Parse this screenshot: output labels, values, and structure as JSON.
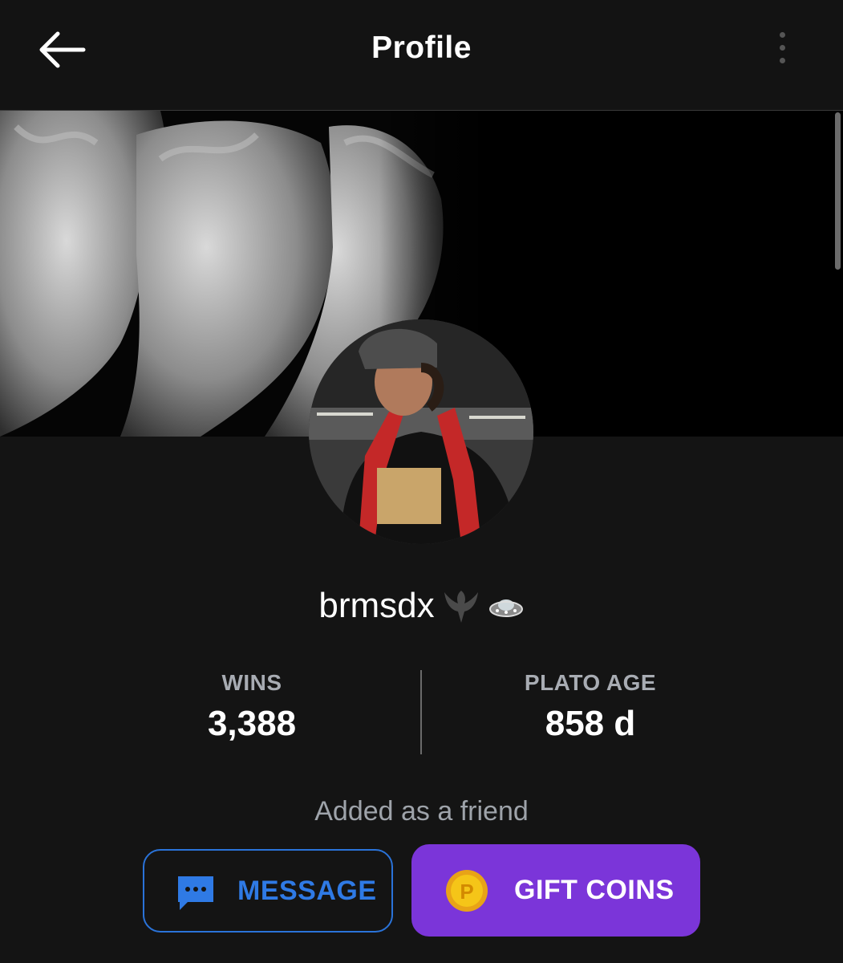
{
  "header": {
    "title": "Profile",
    "back_icon": "arrow-left-icon",
    "more_icon": "more-vertical-icon"
  },
  "cover": {
    "description": "banner image"
  },
  "profile": {
    "username": "brmsdx",
    "badges": [
      "phoenix-badge-icon",
      "ufo-badge-icon"
    ]
  },
  "stats": {
    "wins_label": "WINS",
    "wins_value": "3,388",
    "age_label": "PLATO AGE",
    "age_value": "858 d"
  },
  "friend_status": "Added as a friend",
  "actions": {
    "message_label": "MESSAGE",
    "gift_label": "GIFT COINS"
  },
  "colors": {
    "background": "#141414",
    "message_accent": "#2f7ae5",
    "gift_bg": "#7b35d9",
    "coin": "#f5c518"
  }
}
